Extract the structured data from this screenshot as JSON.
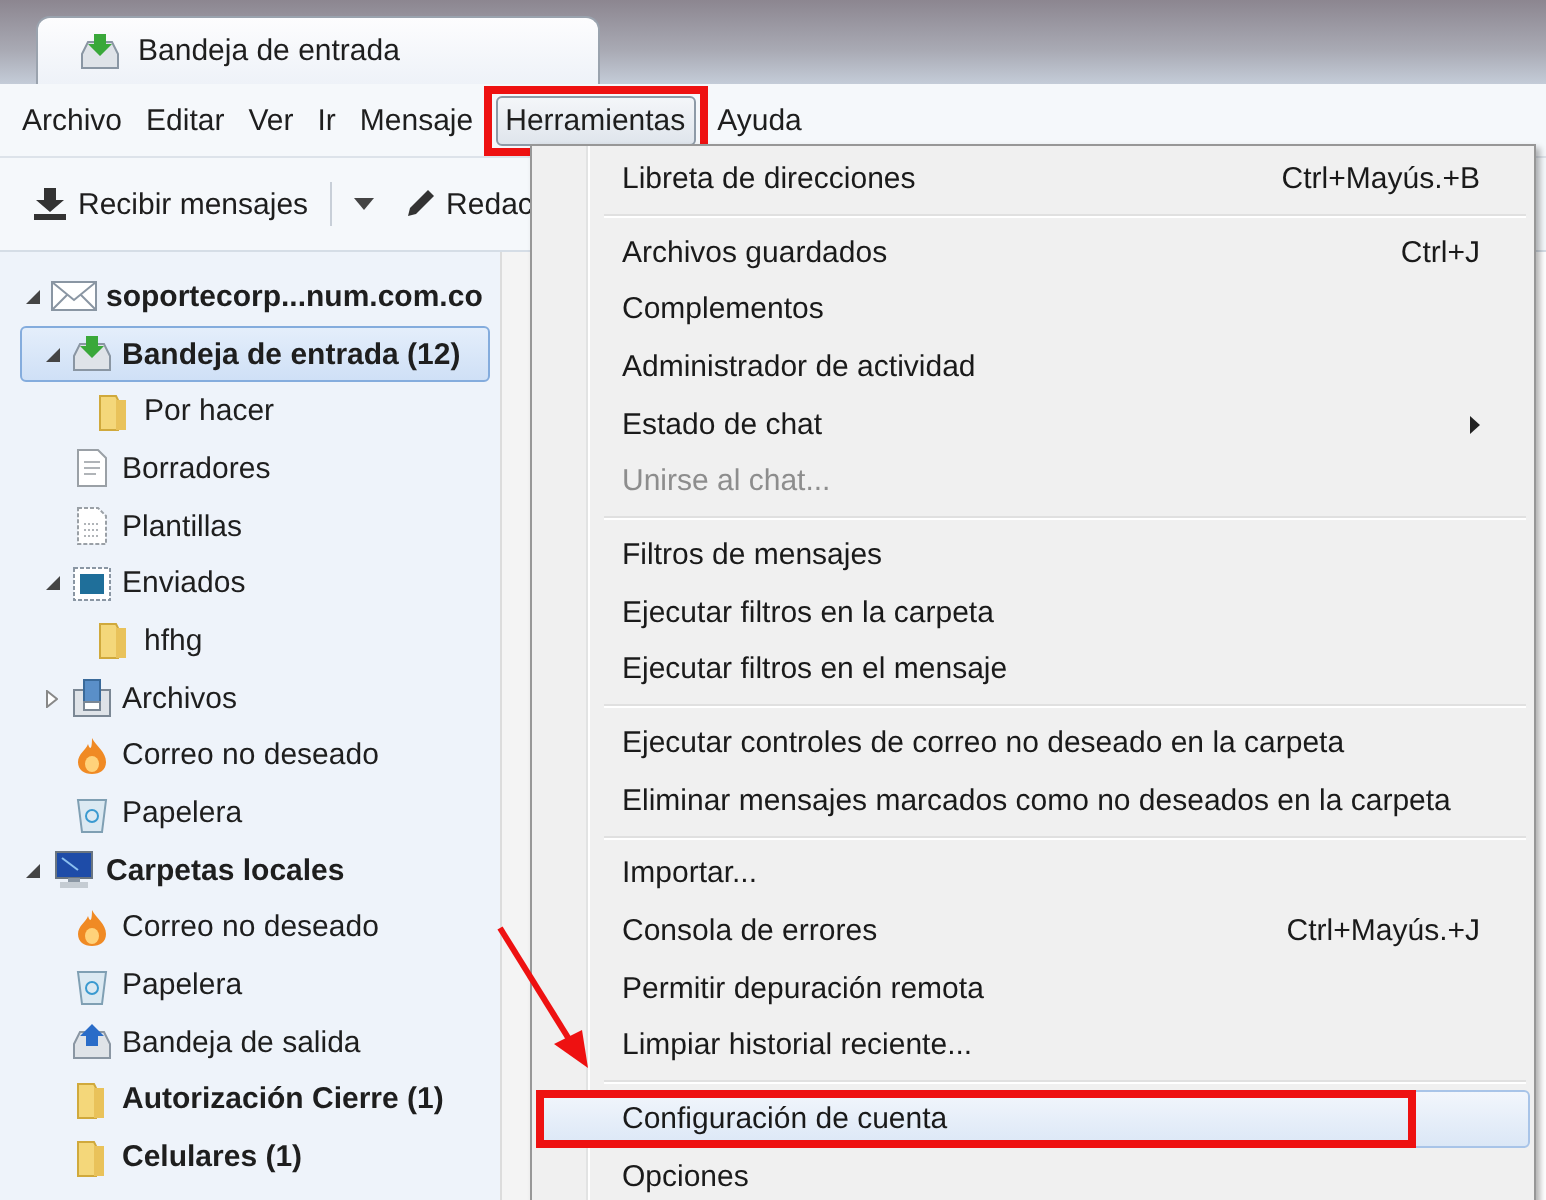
{
  "tab": {
    "title": "Bandeja de entrada"
  },
  "menu_bar": [
    {
      "label": "Archivo",
      "selected": false,
      "annotated": false
    },
    {
      "label": "Editar",
      "selected": false,
      "annotated": false
    },
    {
      "label": "Ver",
      "selected": false,
      "annotated": false
    },
    {
      "label": "Ir",
      "selected": false,
      "annotated": false
    },
    {
      "label": "Mensaje",
      "selected": false,
      "annotated": false
    },
    {
      "label": "Herramientas",
      "selected": true,
      "annotated": true
    },
    {
      "label": "Ayuda",
      "selected": false,
      "annotated": false
    }
  ],
  "toolbar": {
    "get_messages": "Recibir mensajes",
    "compose": "Redac"
  },
  "folders": [
    {
      "name": "soportecorp...num.com.co",
      "kind": "account",
      "unread": true,
      "selected": false,
      "expanded": true,
      "children": [
        {
          "name": "Bandeja de entrada (12)",
          "kind": "inbox",
          "unread": true,
          "selected": true,
          "expanded": true,
          "children": [
            {
              "name": "Por hacer",
              "kind": "folder",
              "unread": false,
              "selected": false
            }
          ]
        },
        {
          "name": "Borradores",
          "kind": "drafts",
          "unread": false,
          "selected": false
        },
        {
          "name": "Plantillas",
          "kind": "templates",
          "unread": false,
          "selected": false
        },
        {
          "name": "Enviados",
          "kind": "sent",
          "unread": false,
          "selected": false,
          "expanded": true,
          "children": [
            {
              "name": "hfhg",
              "kind": "folder",
              "unread": false,
              "selected": false
            }
          ]
        },
        {
          "name": "Archivos",
          "kind": "archive",
          "unread": false,
          "selected": false,
          "expanded": false
        },
        {
          "name": "Correo no deseado",
          "kind": "junk",
          "unread": false,
          "selected": false
        },
        {
          "name": "Papelera",
          "kind": "trash",
          "unread": false,
          "selected": false
        }
      ]
    },
    {
      "name": "Carpetas locales",
      "kind": "local",
      "unread": true,
      "selected": false,
      "expanded": true,
      "children": [
        {
          "name": "Correo no deseado",
          "kind": "junk",
          "unread": false,
          "selected": false
        },
        {
          "name": "Papelera",
          "kind": "trash",
          "unread": false,
          "selected": false
        },
        {
          "name": "Bandeja de salida",
          "kind": "outbox",
          "unread": false,
          "selected": false
        },
        {
          "name": "Autorización Cierre (1)",
          "kind": "folder",
          "unread": true,
          "selected": false
        },
        {
          "name": "Celulares (1)",
          "kind": "folder",
          "unread": true,
          "selected": false
        }
      ]
    }
  ],
  "tools_menu": [
    {
      "kind": "item",
      "label": "Libreta de direcciones",
      "shortcut": "Ctrl+Mayús.+B",
      "disabled": false,
      "submenu": false,
      "selected": false,
      "annotated": false
    },
    {
      "kind": "separator"
    },
    {
      "kind": "item",
      "label": "Archivos guardados",
      "shortcut": "Ctrl+J",
      "disabled": false,
      "submenu": false,
      "selected": false,
      "annotated": false
    },
    {
      "kind": "item",
      "label": "Complementos",
      "disabled": false,
      "submenu": false,
      "selected": false,
      "annotated": false
    },
    {
      "kind": "item",
      "label": "Administrador de actividad",
      "disabled": false,
      "submenu": false,
      "selected": false,
      "annotated": false
    },
    {
      "kind": "item",
      "label": "Estado de chat",
      "disabled": false,
      "submenu": true,
      "selected": false,
      "annotated": false
    },
    {
      "kind": "item",
      "label": "Unirse al chat...",
      "disabled": true,
      "submenu": false,
      "selected": false,
      "annotated": false
    },
    {
      "kind": "separator"
    },
    {
      "kind": "item",
      "label": "Filtros de mensajes",
      "disabled": false,
      "submenu": false,
      "selected": false,
      "annotated": false
    },
    {
      "kind": "item",
      "label": "Ejecutar filtros en la carpeta",
      "disabled": false,
      "submenu": false,
      "selected": false,
      "annotated": false
    },
    {
      "kind": "item",
      "label": "Ejecutar filtros en el mensaje",
      "disabled": false,
      "submenu": false,
      "selected": false,
      "annotated": false
    },
    {
      "kind": "separator"
    },
    {
      "kind": "item",
      "label": "Ejecutar controles de correo no deseado en la carpeta",
      "disabled": false,
      "submenu": false,
      "selected": false,
      "annotated": false
    },
    {
      "kind": "item",
      "label": "Eliminar mensajes marcados como no deseados en la carpeta",
      "disabled": false,
      "submenu": false,
      "selected": false,
      "annotated": false
    },
    {
      "kind": "separator"
    },
    {
      "kind": "item",
      "label": "Importar...",
      "disabled": false,
      "submenu": false,
      "selected": false,
      "annotated": false
    },
    {
      "kind": "item",
      "label": "Consola de errores",
      "shortcut": "Ctrl+Mayús.+J",
      "disabled": false,
      "submenu": false,
      "selected": false,
      "annotated": false
    },
    {
      "kind": "item",
      "label": "Permitir depuración remota",
      "disabled": false,
      "submenu": false,
      "selected": false,
      "annotated": false
    },
    {
      "kind": "item",
      "label": "Limpiar historial reciente...",
      "disabled": false,
      "submenu": false,
      "selected": false,
      "annotated": false
    },
    {
      "kind": "separator"
    },
    {
      "kind": "item",
      "label": "Configuración de cuenta",
      "disabled": false,
      "submenu": false,
      "selected": true,
      "annotated": true
    },
    {
      "kind": "item",
      "label": "Opciones",
      "disabled": false,
      "submenu": false,
      "selected": false,
      "annotated": false
    }
  ]
}
